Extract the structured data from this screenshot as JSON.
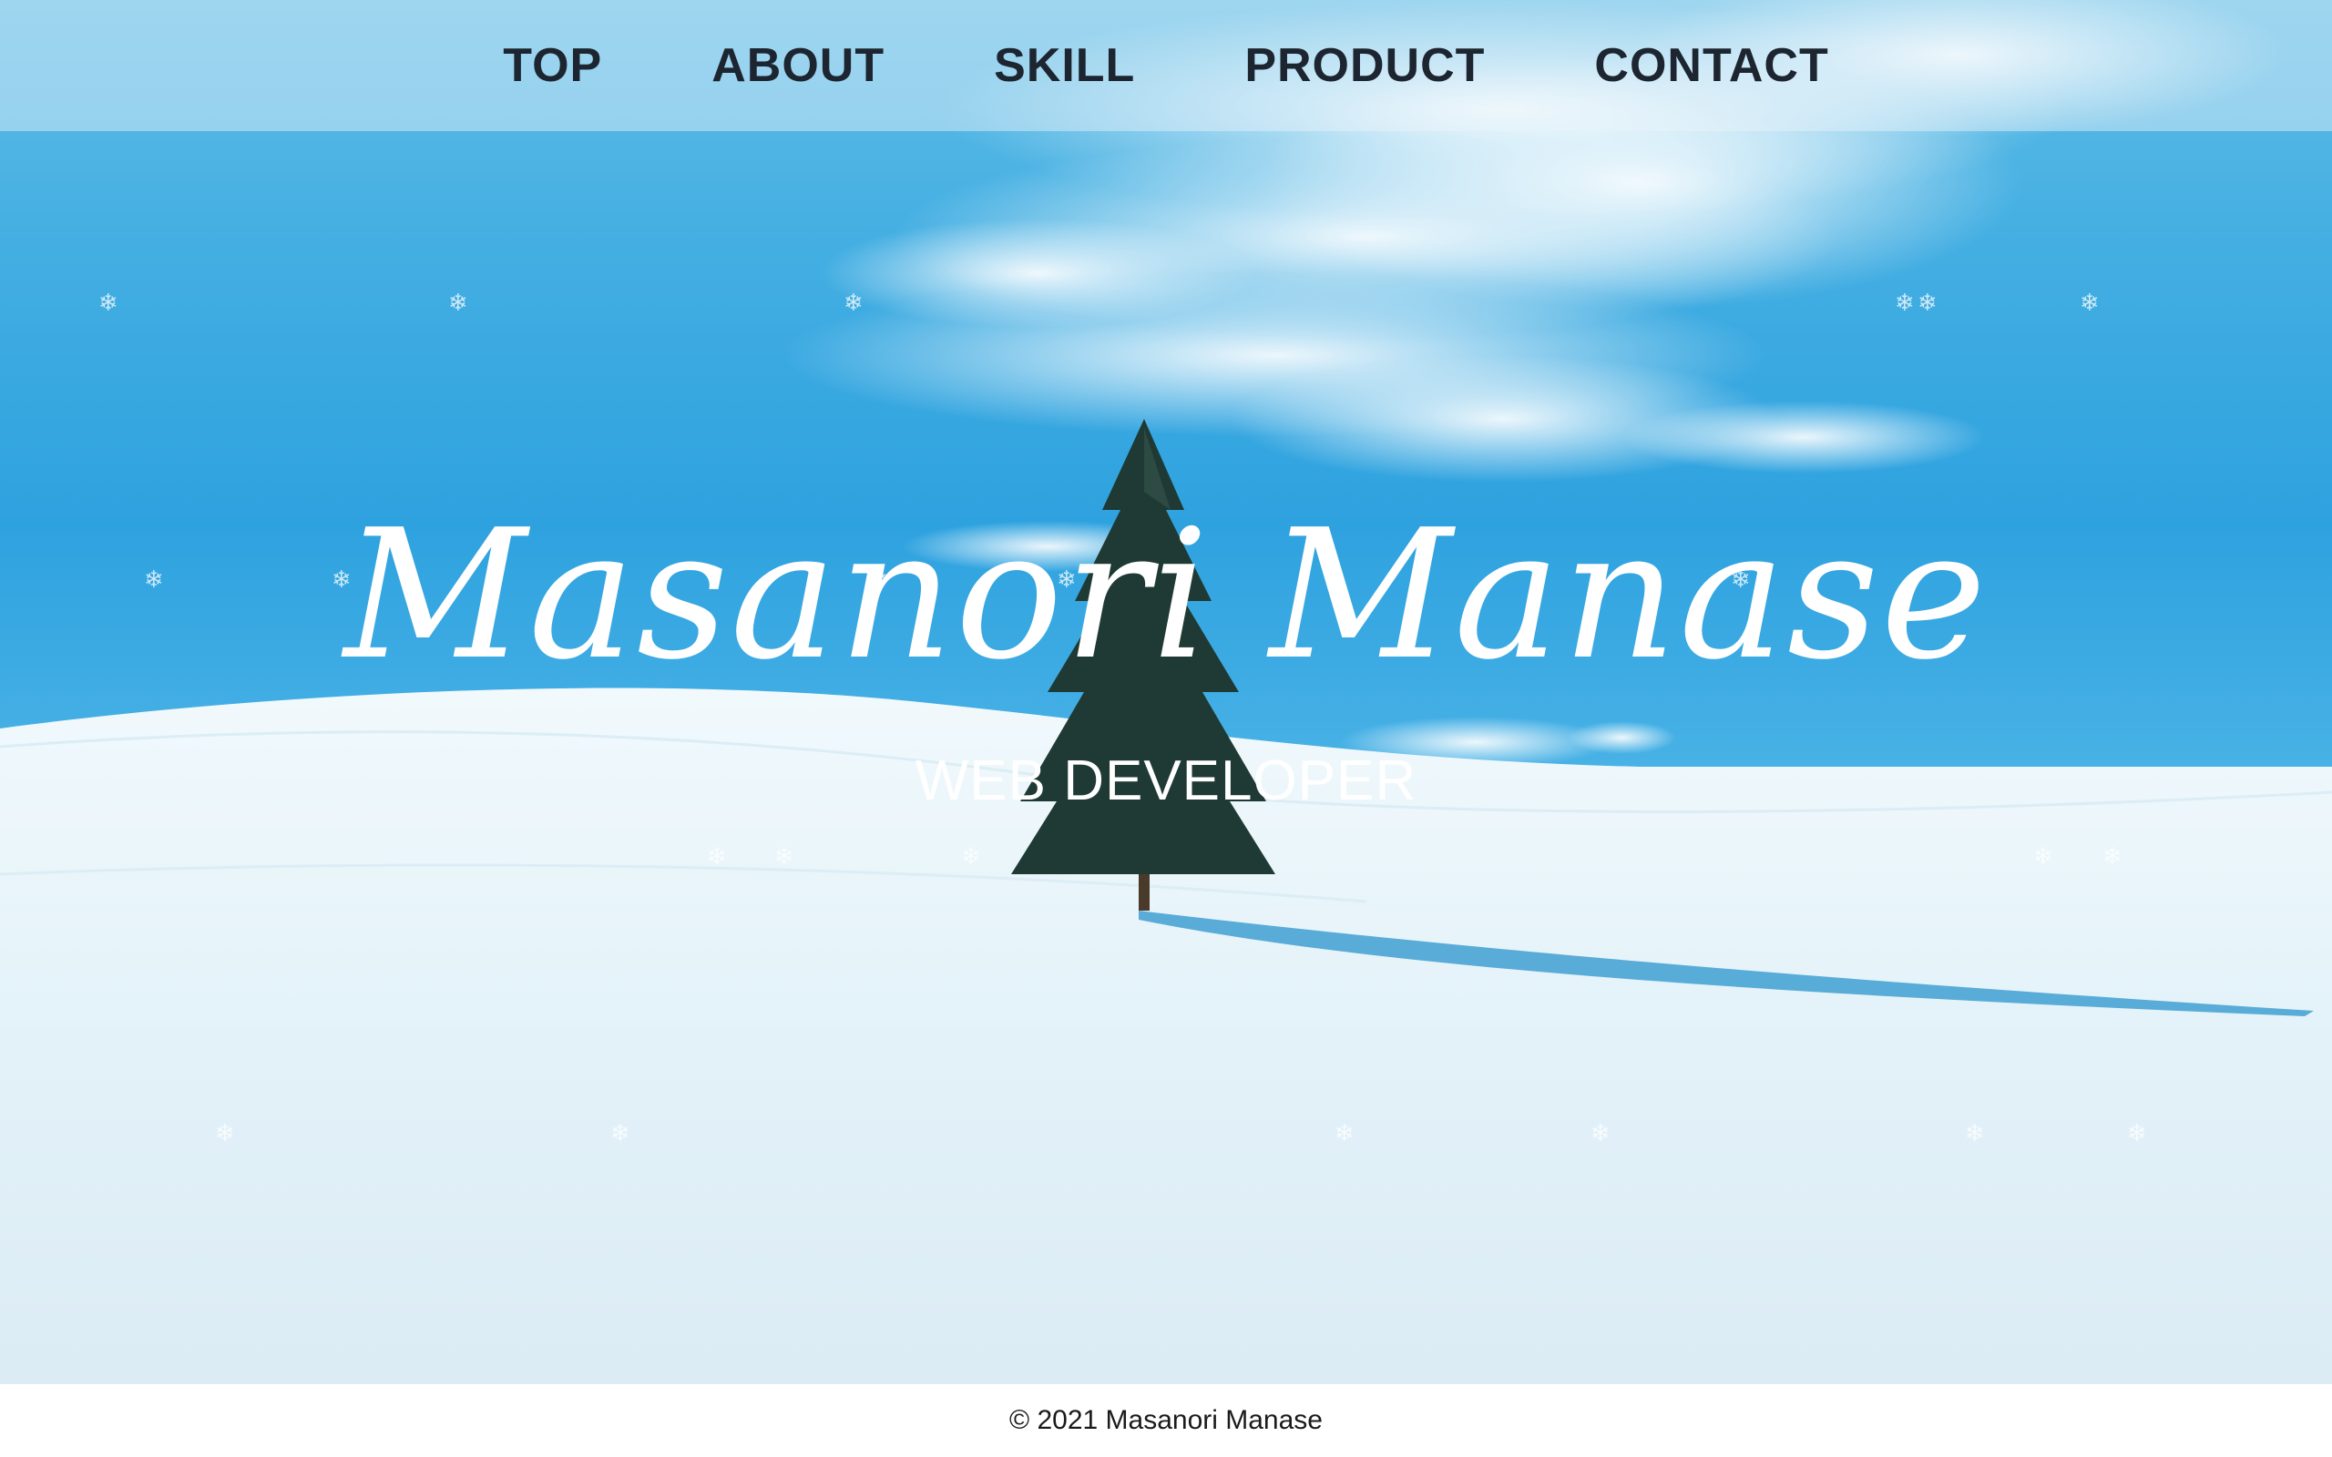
{
  "nav": {
    "items": [
      {
        "label": "TOP"
      },
      {
        "label": "ABOUT"
      },
      {
        "label": "SKILL"
      },
      {
        "label": "PRODUCT"
      },
      {
        "label": "CONTACT"
      }
    ]
  },
  "hero": {
    "title": "Masanori Manase",
    "subtitle": "WEB DEVELOPER",
    "snowflake_glyph": "❄"
  },
  "footer": {
    "copyright": "© 2021 Masanori Manase"
  },
  "colors": {
    "sky": "#2ea2df",
    "snow": "#e9f6fb",
    "text_dark": "#1c2530",
    "hero_text": "#ffffff"
  }
}
